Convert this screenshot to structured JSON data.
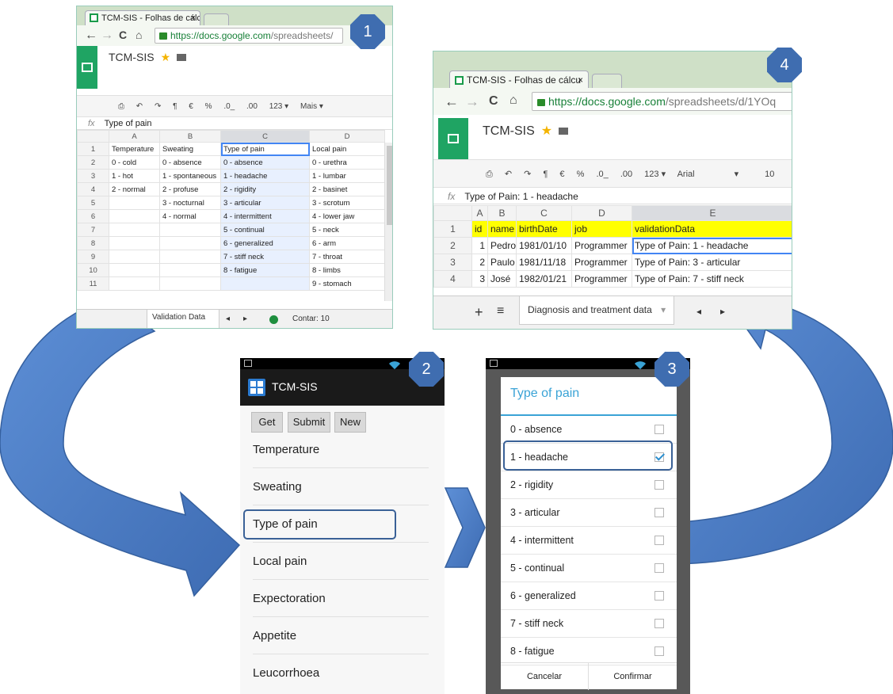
{
  "window1": {
    "tab_title": "TCM-SIS - Folhas de cálcu",
    "tab_close": "×",
    "url_highlight": "https://docs.google.com",
    "url_rest": "/spreadsheets/",
    "doc_title": "TCM-SIS",
    "toolbar": {
      "currency": "€",
      "percent": "%",
      "dec_less": ".0_",
      "dec_more": ".00",
      "number_format": "123 ▾",
      "more": "Mais ▾"
    },
    "fx": "fx",
    "formula_value": "Type of pain",
    "columns": [
      "A",
      "B",
      "C",
      "D"
    ],
    "rows": [
      [
        "1",
        "Temperature",
        "Sweating",
        "Type of pain",
        "Local pain"
      ],
      [
        "2",
        "0 - cold",
        "0 - absence",
        "0 - absence",
        "0 - urethra"
      ],
      [
        "3",
        "1 - hot",
        "1 - spontaneous",
        "1 - headache",
        "1 - lumbar"
      ],
      [
        "4",
        "2 - normal",
        "2 - profuse",
        "2 - rigidity",
        "2 - basinet"
      ],
      [
        "5",
        "",
        "3 - nocturnal",
        "3 - articular",
        "3 - scrotum"
      ],
      [
        "6",
        "",
        "4 - normal",
        "4 - intermittent",
        "4 - lower jaw"
      ],
      [
        "7",
        "",
        "",
        "5 - continual",
        "5 - neck"
      ],
      [
        "8",
        "",
        "",
        "6 - generalized",
        "6 - arm"
      ],
      [
        "9",
        "",
        "",
        "7 - stiff neck",
        "7 - throat"
      ],
      [
        "10",
        "",
        "",
        "8 - fatigue",
        "8 - limbs"
      ],
      [
        "11",
        "",
        "",
        "",
        "9 - stomach"
      ]
    ],
    "sheet_tab": "Validation Data",
    "count_label": "Contar: 10"
  },
  "window4": {
    "tab_title": "TCM-SIS - Folhas de cálcu",
    "tab_close": "×",
    "url_highlight": "https://docs.google.com",
    "url_rest": "/spreadsheets/d/1YOq",
    "doc_title": "TCM-SIS",
    "toolbar": {
      "currency": "€",
      "percent": "%",
      "dec_less": ".0_",
      "dec_more": ".00",
      "number_format": "123 ▾",
      "font": "Arial",
      "font_arrow": "▾",
      "size": "10"
    },
    "fx": "fx",
    "formula_value": "Type of Pain: 1 - headache",
    "columns": [
      "A",
      "B",
      "C",
      "D",
      "E"
    ],
    "rows": [
      [
        "1",
        "id",
        "name",
        "birthDate",
        "job",
        "validationData"
      ],
      [
        "2",
        "1",
        "Pedro",
        "1981/01/10",
        "Programmer",
        "Type of Pain: 1 - headache"
      ],
      [
        "3",
        "2",
        "Paulo",
        "1981/11/18",
        "Programmer",
        "Type of Pain: 3 - articular"
      ],
      [
        "4",
        "3",
        "José",
        "1982/01/21",
        "Programmer",
        "Type of Pain: 7 - stiff neck"
      ]
    ],
    "add_sheet": "+",
    "sheet_list": "≡",
    "sheet_tab": "Diagnosis and treatment data",
    "sheet_tab_arrow": "▾"
  },
  "phone2": {
    "app_title": "TCM-SIS",
    "buttons": [
      "Get",
      "Submit",
      "New"
    ],
    "items": [
      "Temperature",
      "Sweating",
      "Type of pain",
      "Local pain",
      "Expectoration",
      "Appetite",
      "Leucorrhoea"
    ]
  },
  "phone3": {
    "dialog_title": "Type of pain",
    "options": [
      "0 - absence",
      "1 - headache",
      "2 - rigidity",
      "3 - articular",
      "4 - intermittent",
      "5 - continual",
      "6 - generalized",
      "7 - stiff neck",
      "8 - fatigue"
    ],
    "checked_index": 1,
    "cancel": "Cancelar",
    "confirm": "Confirmar"
  },
  "badges": [
    "1",
    "2",
    "3",
    "4"
  ],
  "colors": {
    "arrow": "#4a7bc3",
    "badge": "#3f6db0",
    "sheets_green": "#1fa463",
    "dialog_accent": "#3aa3d6",
    "highlight": "#3a6197"
  }
}
